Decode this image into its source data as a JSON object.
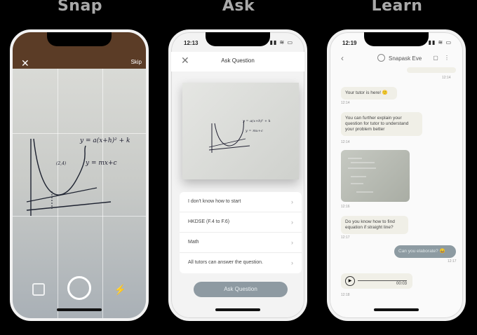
{
  "headings": [
    "Snap",
    "Ask",
    "Learn"
  ],
  "snap": {
    "close_icon": "close-icon",
    "skip_label": "Skip",
    "equation_top": "y = a(x+h)² + k",
    "equation_line": "y = mx+c",
    "point_label": "(2,4)"
  },
  "ask": {
    "time": "12:13",
    "status_icons": "▮▮ ≋ ▭",
    "title": "Ask Question",
    "options": [
      "I don't know how to start",
      "HKDSE (F.4 to F.6)",
      "Math",
      "All tutors can answer the question."
    ],
    "button": "Ask Question"
  },
  "learn": {
    "time": "12:19",
    "status_icons": "▮▮ ≋ ▭",
    "tutor_name": "Snapask Eve",
    "messages": [
      {
        "text": "Your tutor is here! 🙂",
        "time": "12:14"
      },
      {
        "text": "You can further explain your question for tutor to understand your problem better",
        "time": "12:14"
      },
      {
        "text": "",
        "time": "12:16"
      },
      {
        "text": "Do you know how to find equation if straight line?",
        "time": "12:17"
      },
      {
        "text": "Can you elaborate? 😄",
        "time": "12:17"
      },
      {
        "text": "00:03",
        "time": "12:18"
      }
    ],
    "top_time": "12:14"
  }
}
